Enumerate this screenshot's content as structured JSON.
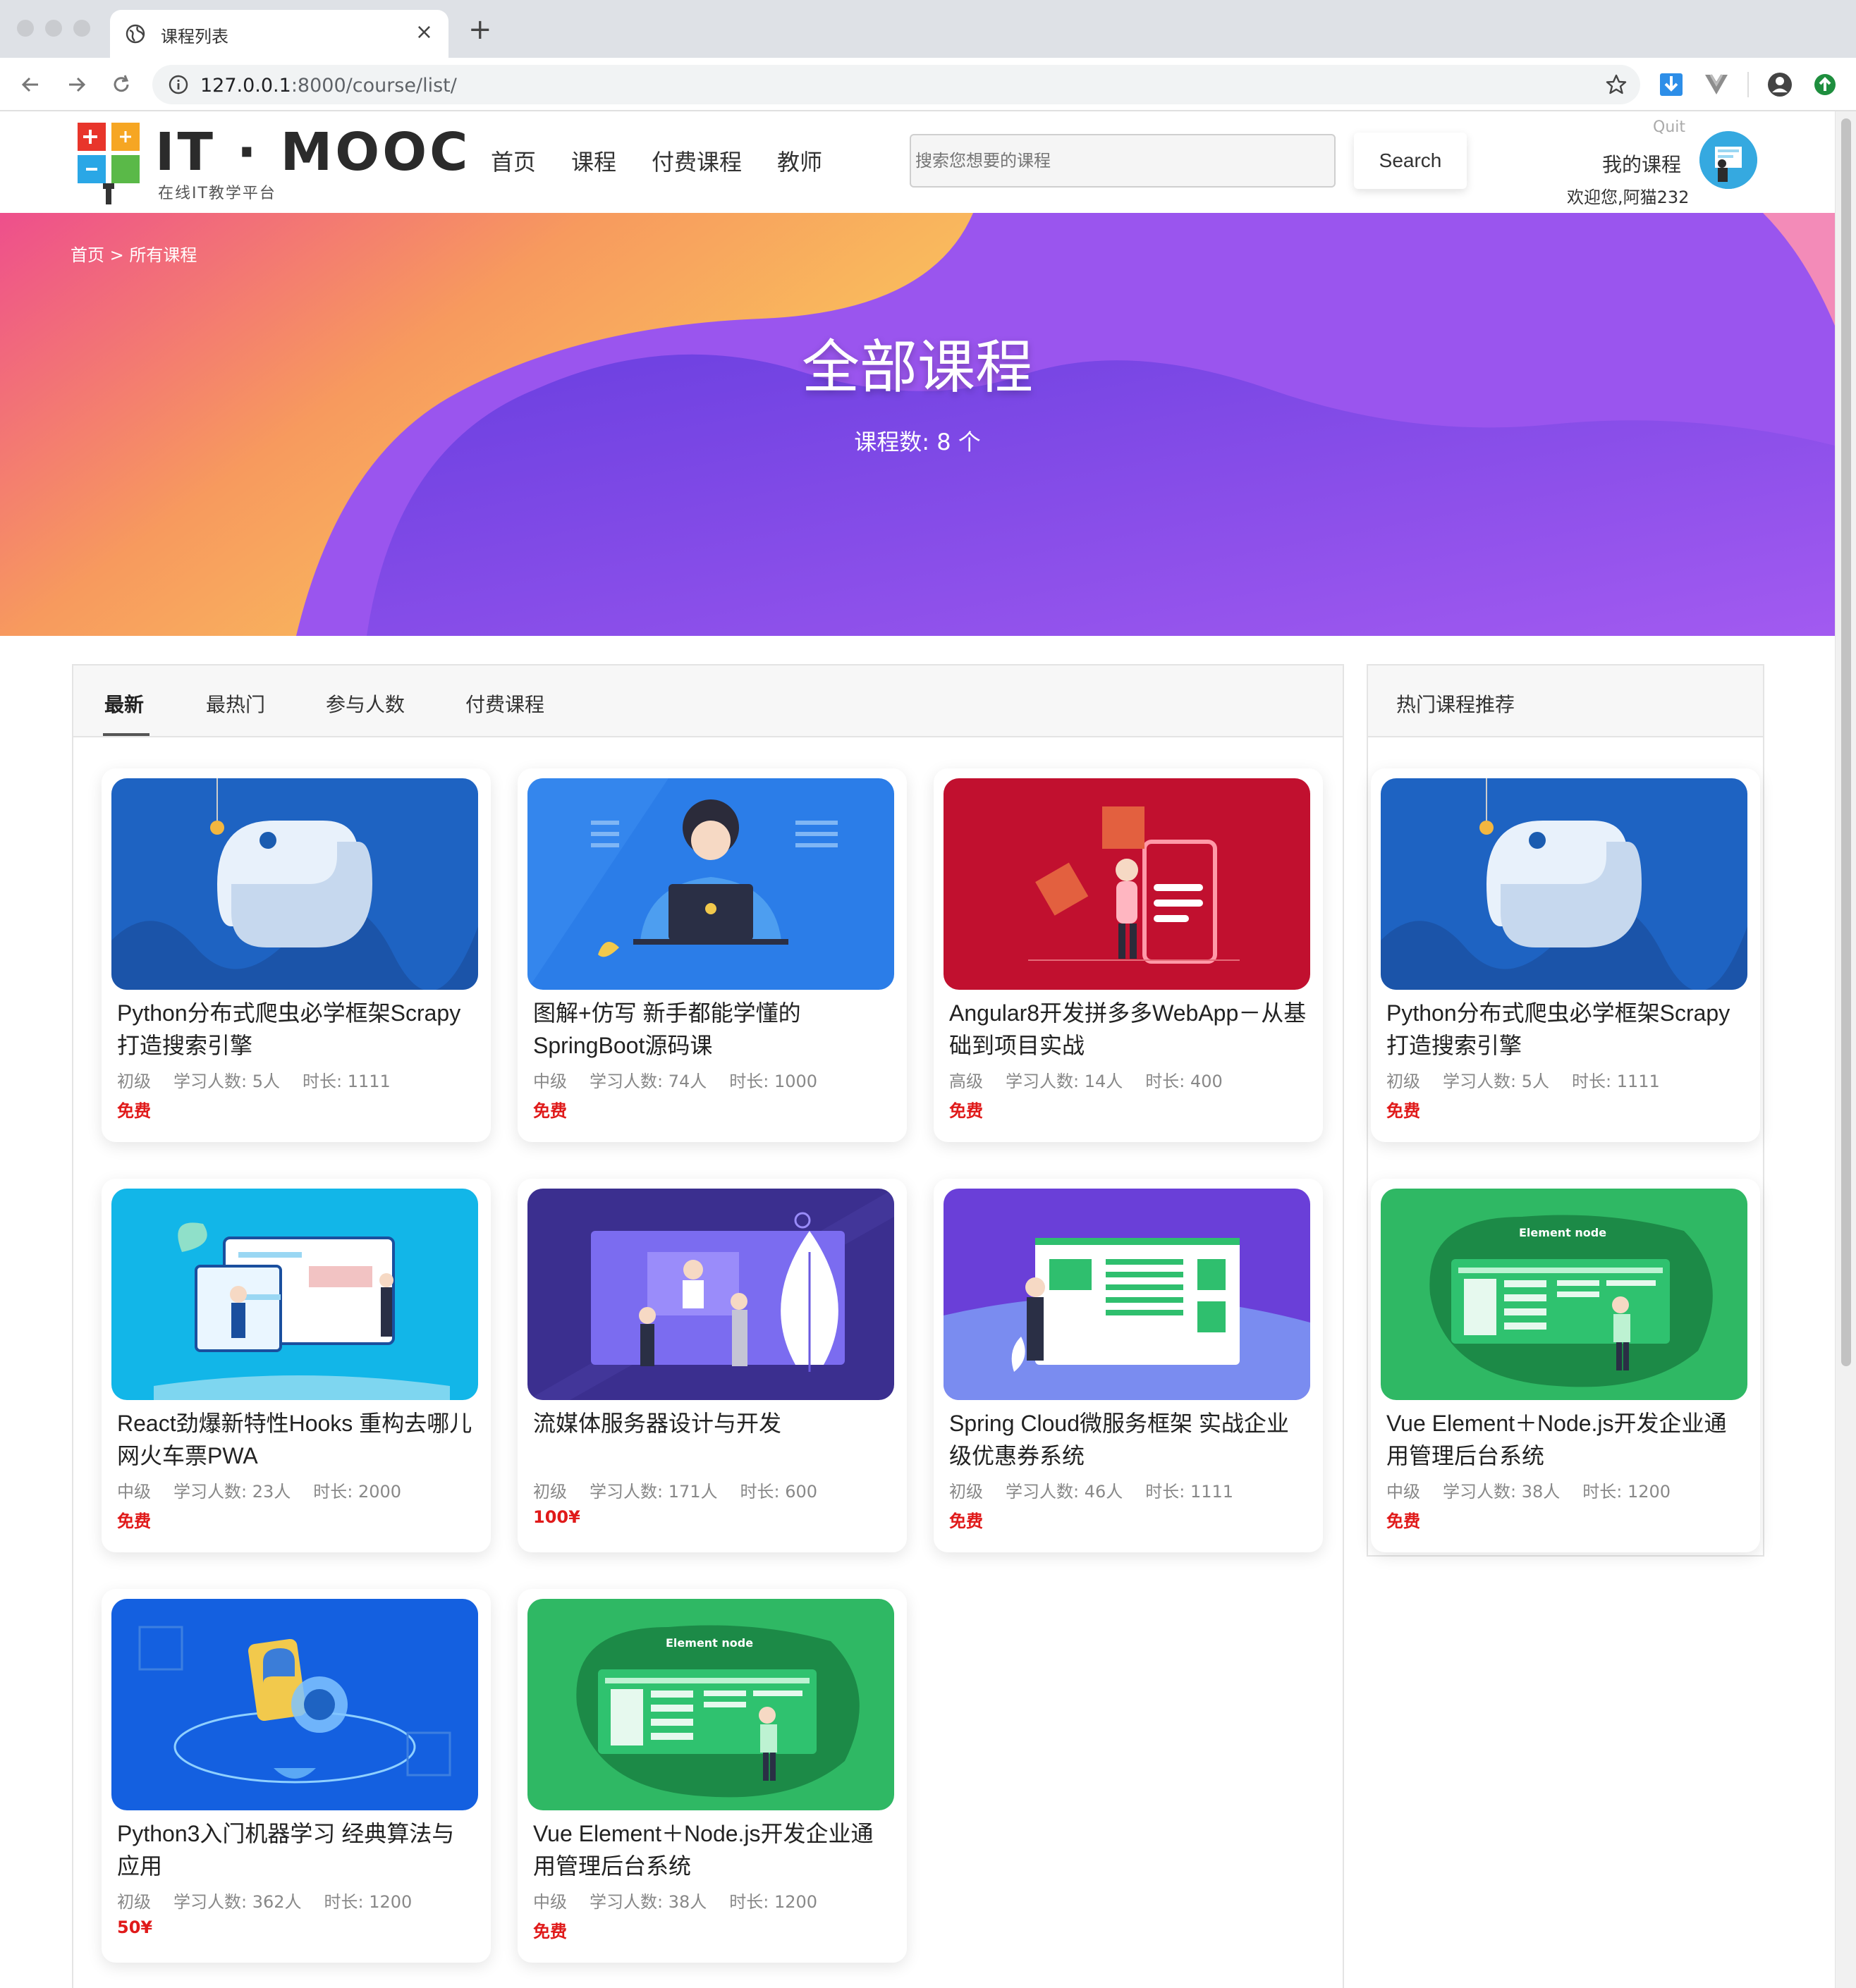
{
  "browser": {
    "tab_title": "课程列表",
    "url_host": "127.0.0.1",
    "url_rest": ":8000/course/list/"
  },
  "header": {
    "logo_text": "IT · MOOC",
    "logo_sub": "在线IT教学平台",
    "nav": [
      "首页",
      "课程",
      "付费课程",
      "教师"
    ],
    "search_placeholder": "搜索您想要的课程",
    "search_button": "Search",
    "quit": "Quit",
    "my_courses": "我的课程",
    "welcome": "欢迎您,阿猫232"
  },
  "hero": {
    "breadcrumb": "首页 > 所有课程",
    "title": "全部课程",
    "count": "课程数: 8 个"
  },
  "sort_tabs": [
    "最新",
    "最热门",
    "参与人数",
    "付费课程"
  ],
  "courses": [
    {
      "title": "Python分布式爬虫必学框架Scrapy打造搜索引擎",
      "level": "初级",
      "students": "学习人数: 5人",
      "duration": "时长: 1111",
      "price": "免费",
      "theme": "python-blue"
    },
    {
      "title": "图解+仿写 新手都能学懂的SpringBoot源码课",
      "level": "中级",
      "students": "学习人数: 74人",
      "duration": "时长: 1000",
      "price": "免费",
      "theme": "blue-laptop"
    },
    {
      "title": "Angular8开发拼多多WebApp－从基础到项目实战",
      "level": "高级",
      "students": "学习人数: 14人",
      "duration": "时长: 400",
      "price": "免费",
      "theme": "red-phone"
    },
    {
      "title": "React劲爆新特性Hooks 重构去哪儿网火车票PWA",
      "level": "中级",
      "students": "学习人数: 23人",
      "duration": "时长: 2000",
      "price": "免费",
      "theme": "cyan-screens"
    },
    {
      "title": "流媒体服务器设计与开发",
      "level": "初级",
      "students": "学习人数: 171人",
      "duration": "时长: 600",
      "price": "100¥",
      "theme": "purple-video"
    },
    {
      "title": "Spring Cloud微服务框架 实战企业级优惠券系统",
      "level": "初级",
      "students": "学习人数: 46人",
      "duration": "时长: 1111",
      "price": "免费",
      "theme": "violet-coupon"
    },
    {
      "title": "Python3入门机器学习 经典算法与应用",
      "level": "初级",
      "students": "学习人数: 362人",
      "duration": "时长: 1200",
      "price": "50¥",
      "theme": "blue-ml"
    },
    {
      "title": "Vue Element＋Node.js开发企业通用管理后台系统",
      "level": "中级",
      "students": "学习人数: 38人",
      "duration": "时长: 1200",
      "price": "免费",
      "theme": "green-node"
    }
  ],
  "side": {
    "title": "热门课程推荐",
    "courses": [
      {
        "title": "Python分布式爬虫必学框架Scrapy打造搜索引擎",
        "level": "初级",
        "students": "学习人数: 5人",
        "duration": "时长: 1111",
        "price": "免费",
        "theme": "python-blue"
      },
      {
        "title": "Vue Element＋Node.js开发企业通用管理后台系统",
        "level": "中级",
        "students": "学习人数: 38人",
        "duration": "时长: 1200",
        "price": "免费",
        "theme": "green-node"
      }
    ]
  },
  "image_labels": {
    "element_node": "Element node"
  },
  "colors": {
    "price_red": "#e01a1a",
    "hero_purple": "#8e4be8",
    "hero_yellow": "#f8c85a",
    "hero_pink": "#ee5a8a"
  }
}
